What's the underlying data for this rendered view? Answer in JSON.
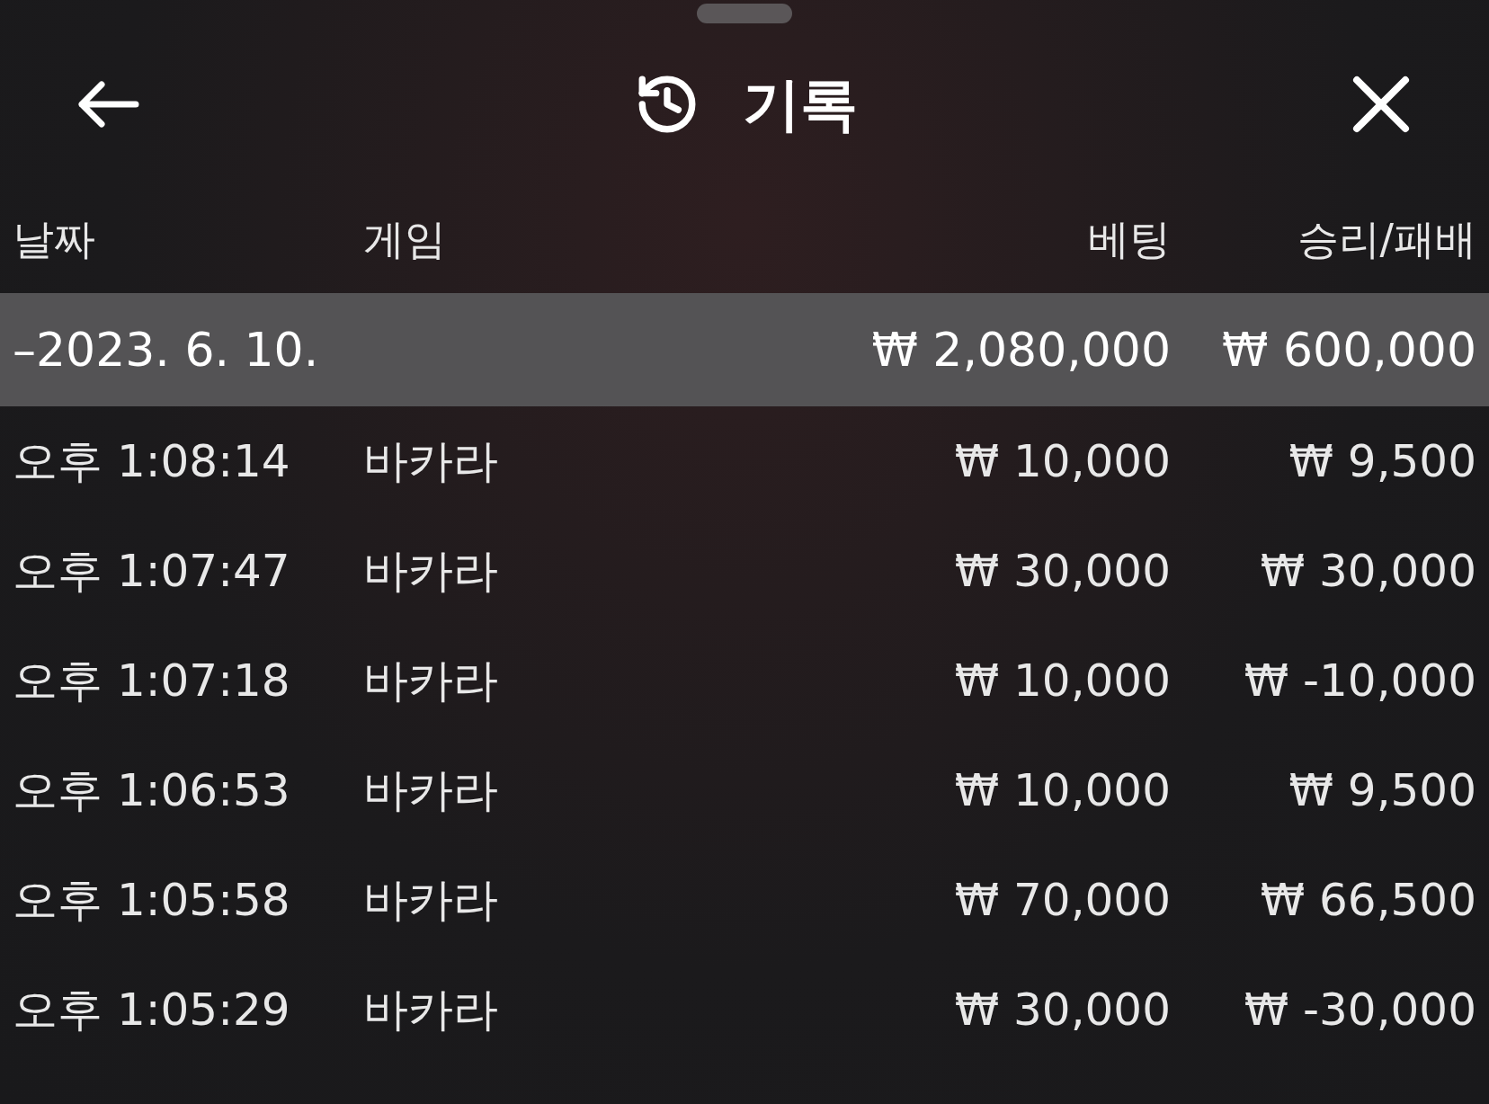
{
  "header": {
    "title": "기록"
  },
  "columns": [
    "날짜",
    "게임",
    "베팅",
    "승리/패배"
  ],
  "group": {
    "date": "–2023. 6. 10.",
    "bet": "₩ 2,080,000",
    "result": "₩ 600,000"
  },
  "rows": [
    {
      "time": "오후 1:08:14",
      "game": "바카라",
      "bet": "₩ 10,000",
      "result": "₩ 9,500"
    },
    {
      "time": "오후 1:07:47",
      "game": "바카라",
      "bet": "₩ 30,000",
      "result": "₩ 30,000"
    },
    {
      "time": "오후 1:07:18",
      "game": "바카라",
      "bet": "₩ 10,000",
      "result": "₩ -10,000"
    },
    {
      "time": "오후 1:06:53",
      "game": "바카라",
      "bet": "₩ 10,000",
      "result": "₩ 9,500"
    },
    {
      "time": "오후 1:05:58",
      "game": "바카라",
      "bet": "₩ 70,000",
      "result": "₩ 66,500"
    },
    {
      "time": "오후 1:05:29",
      "game": "바카라",
      "bet": "₩ 30,000",
      "result": "₩ -30,000"
    }
  ]
}
